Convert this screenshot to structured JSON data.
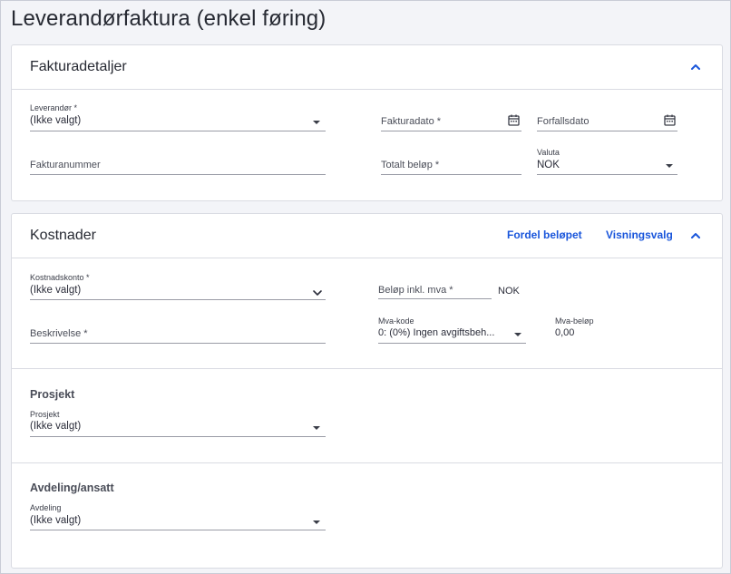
{
  "page": {
    "title": "Leverandørfaktura (enkel føring)"
  },
  "invoice_details": {
    "title": "Fakturadetaljer",
    "supplier": {
      "label": "Leverandør *",
      "value": "(Ikke valgt)"
    },
    "invoice_date": {
      "placeholder": "Fakturadato *"
    },
    "due_date": {
      "placeholder": "Forfallsdato"
    },
    "invoice_number": {
      "placeholder": "Fakturanummer"
    },
    "total_amount": {
      "placeholder": "Totalt beløp *"
    },
    "currency": {
      "label": "Valuta",
      "value": "NOK"
    }
  },
  "costs": {
    "title": "Kostnader",
    "distribute_label": "Fordel beløpet",
    "view_options_label": "Visningsvalg",
    "cost_account": {
      "label": "Kostnadskonto *",
      "value": "(Ikke valgt)"
    },
    "amount_incl_vat": {
      "placeholder": "Beløp inkl. mva *",
      "currency": "NOK"
    },
    "description": {
      "placeholder": "Beskrivelse *"
    },
    "vat_code": {
      "label": "Mva-kode",
      "value": "0: (0%) Ingen avgiftsbeh..."
    },
    "vat_amount": {
      "label": "Mva-beløp",
      "value": "0,00"
    },
    "project_section": {
      "title": "Prosjekt",
      "label": "Prosjekt",
      "value": "(Ikke valgt)"
    },
    "department_section": {
      "title": "Avdeling/ansatt",
      "label": "Avdeling",
      "value": "(Ikke valgt)"
    }
  }
}
